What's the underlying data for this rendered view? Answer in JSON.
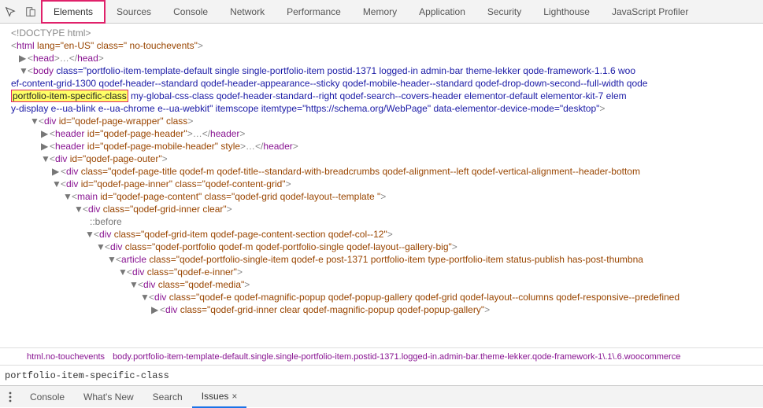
{
  "tabs": {
    "elements": "Elements",
    "sources": "Sources",
    "console": "Console",
    "network": "Network",
    "performance": "Performance",
    "memory": "Memory",
    "application": "Application",
    "security": "Security",
    "lighthouse": "Lighthouse",
    "jsprofiler": "JavaScript Profiler"
  },
  "dom": {
    "l0": "<!DOCTYPE html>",
    "l1_open": "<",
    "l1_tag": "html",
    "l1_attrs": " lang=\"en-US\" class=\" no-touchevents\"",
    "l1_close": ">",
    "l2_open": "<",
    "l2_tag": "head",
    "l2_mid": ">…</",
    "l2_end": ">",
    "l3_tag": "body",
    "l3_pre": "class=\"",
    "l3_seg1": "portfolio-item-template-default single single-portfolio-item postid-1371 logged-in admin-bar theme-lekker qode-framework-1.1.6 woo",
    "l4_seg": "ef-content-grid-1300 qodef-header--standard qodef-header-appearance--sticky qodef-mobile-header--standard qodef-drop-down-second--full-width qode",
    "l5_h": "portfolio-item-specific-class",
    "l5_seg": " my-global-css-class qodef-header-standard--right qodef-search--covers-header elementor-default elementor-kit-7 elem",
    "l6_seg": "y-display e--ua-blink e--ua-chrome e--ua-webkit\" itemscope itemtype=\"https://schema.org/WebPage\" data-elementor-device-mode=\"desktop\"",
    "l7_tag": "div",
    "l7_attrs": " id=\"qodef-page-wrapper\" class",
    "l8_tag": "header",
    "l8_attrs": " id=\"qodef-page-header\"",
    "l8_close": ">…</",
    "l9_attrs": " id=\"qodef-page-mobile-header\" style",
    "l10_attrs": " id=\"qodef-page-outer\"",
    "l11_attrs": " class=\"qodef-page-title qodef-m qodef-title--standard-with-breadcrumbs qodef-alignment--left qodef-vertical-alignment--header-bottom",
    "l12_attrs": " id=\"qodef-page-inner\" class=\"qodef-content-grid\"",
    "l13_tag": "main",
    "l13_attrs": " id=\"qodef-page-content\" class=\"qodef-grid qodef-layout--template \"",
    "l14_attrs": " class=\"qodef-grid-inner clear\"",
    "l15": "::before",
    "l16_attrs": " class=\"qodef-grid-item qodef-page-content-section qodef-col--12\"",
    "l17_attrs": " class=\"qodef-portfolio qodef-m qodef-portfolio-single qodef-layout--gallery-big\"",
    "l18_tag": "article",
    "l18_attrs": " class=\"qodef-portfolio-single-item qodef-e post-1371 portfolio-item type-portfolio-item status-publish has-post-thumbna",
    "l19_attrs": " class=\"qodef-e-inner\"",
    "l20_attrs": " class=\"qodef-media\"",
    "l21_attrs": " class=\"qodef-e qodef-magnific-popup qodef-popup-gallery qodef-grid  qodef-layout--columns qodef-responsive--predefined",
    "l22_attrs": " class=\"qodef-grid-inner clear qodef-magnific-popup qodef-popup-gallery\"",
    "gt": ">"
  },
  "breadcrumbs": {
    "html": "html.no-touchevents",
    "body": "body.portfolio-item-template-default.single.single-portfolio-item.postid-1371.logged-in.admin-bar.theme-lekker.qode-framework-1\\.1\\.6.woocommerce"
  },
  "search": {
    "value": "portfolio-item-specific-class"
  },
  "drawer": {
    "console": "Console",
    "whatsnew": "What's New",
    "search": "Search",
    "issues": "Issues"
  }
}
